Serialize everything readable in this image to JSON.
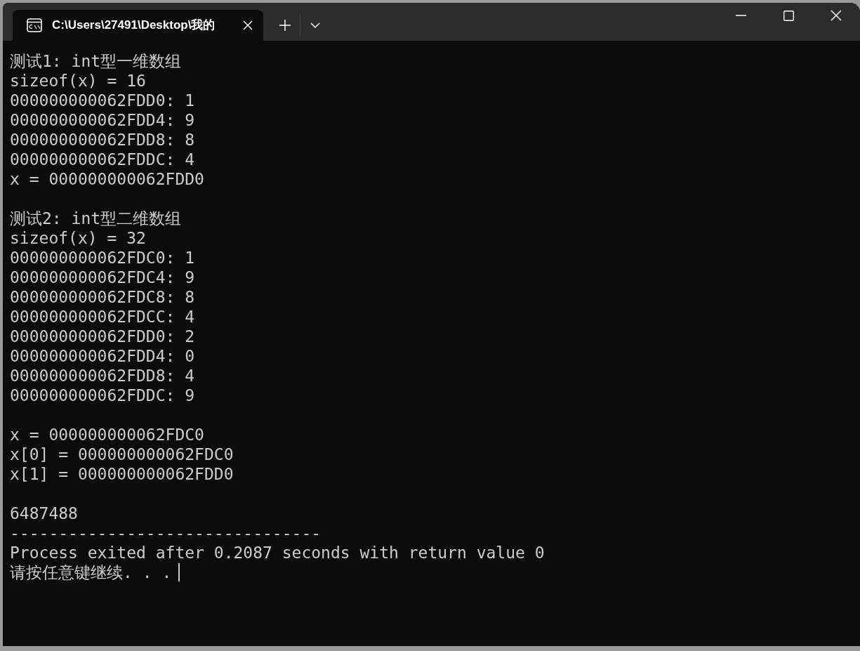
{
  "tab": {
    "title": "C:\\Users\\27491\\Desktop\\我的",
    "selected": true
  },
  "output_blocks": [
    [
      "测试1: int型一维数组",
      "sizeof(x) = 16",
      "000000000062FDD0: 1",
      "000000000062FDD4: 9",
      "000000000062FDD8: 8",
      "000000000062FDDC: 4",
      "x = 000000000062FDD0"
    ],
    [
      "测试2: int型二维数组",
      "sizeof(x) = 32",
      "000000000062FDC0: 1",
      "000000000062FDC4: 9",
      "000000000062FDC8: 8",
      "000000000062FDCC: 4",
      "000000000062FDD0: 2",
      "000000000062FDD4: 0",
      "000000000062FDD8: 4",
      "000000000062FDDC: 9"
    ],
    [
      "x = 000000000062FDC0",
      "x[0] = 000000000062FDC0",
      "x[1] = 000000000062FDD0"
    ],
    [
      "6487488",
      "--------------------------------",
      "Process exited after 0.2087 seconds with return value 0",
      "请按任意键继续. . ."
    ]
  ],
  "cursor_visible": true
}
